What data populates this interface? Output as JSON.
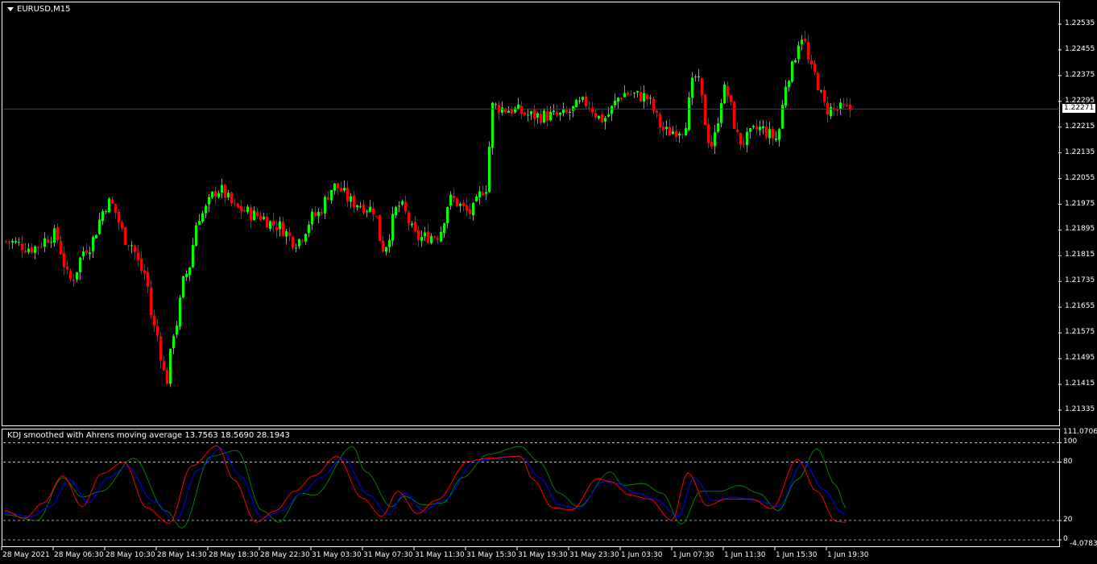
{
  "chart": {
    "title": "EURUSD,M15",
    "symbol": "EURUSD",
    "timeframe": "M15",
    "current_price": "1.22271",
    "price_labels": [
      "1.22535",
      "1.22455",
      "1.22375",
      "1.22295",
      "1.22215",
      "1.22135",
      "1.22055",
      "1.21975",
      "1.21895",
      "1.21815",
      "1.21735",
      "1.21655",
      "1.21575",
      "1.21495",
      "1.21415",
      "1.21335"
    ],
    "time_labels": [
      "28 May 2021",
      "28 May 06:30",
      "28 May 10:30",
      "28 May 14:30",
      "28 May 18:30",
      "28 May 22:30",
      "31 May 03:30",
      "31 May 07:30",
      "31 May 11:30",
      "31 May 15:30",
      "31 May 19:30",
      "31 May 23:30",
      "1 Jun 03:30",
      "1 Jun 07:30",
      "1 Jun 11:30",
      "1 Jun 15:30",
      "1 Jun 19:30"
    ],
    "colors": {
      "background": "#000000",
      "bull": "#00ff00",
      "bear": "#ff0000",
      "price_line": "#3030c0",
      "frame": "#ffffff"
    }
  },
  "indicator": {
    "title": "KDJ smoothed with Ahrens moving average 13.7563 18.5690 28.1943",
    "max_label": "111.0706",
    "level_labels": [
      "100",
      "80",
      "20",
      "0"
    ],
    "min_label": "-4.0783",
    "colors": {
      "k": "#ff0000",
      "d": "#0000ff",
      "j": "#008000",
      "level": "#ffffff"
    }
  },
  "chart_data": {
    "type": "candlestick",
    "title": "EURUSD,M15",
    "ylim": [
      1.2129,
      1.226
    ],
    "close_anchors": [
      [
        0,
        1.2186
      ],
      [
        8,
        1.2184
      ],
      [
        15,
        1.2188
      ],
      [
        20,
        1.2174
      ],
      [
        25,
        1.2184
      ],
      [
        32,
        1.2198
      ],
      [
        38,
        1.2186
      ],
      [
        43,
        1.2176
      ],
      [
        46,
        1.2159
      ],
      [
        50,
        1.2143
      ],
      [
        52,
        1.2158
      ],
      [
        56,
        1.2176
      ],
      [
        60,
        1.2194
      ],
      [
        66,
        1.2202
      ],
      [
        72,
        1.2196
      ],
      [
        78,
        1.2194
      ],
      [
        84,
        1.2191
      ],
      [
        90,
        1.2186
      ],
      [
        96,
        1.2194
      ],
      [
        102,
        1.2203
      ],
      [
        108,
        1.2198
      ],
      [
        114,
        1.2196
      ],
      [
        117,
        1.2184
      ],
      [
        122,
        1.2197
      ],
      [
        128,
        1.2187
      ],
      [
        134,
        1.2188
      ],
      [
        138,
        1.2199
      ],
      [
        144,
        1.2195
      ],
      [
        149,
        1.2203
      ],
      [
        151,
        1.2228
      ],
      [
        156,
        1.2227
      ],
      [
        164,
        1.2225
      ],
      [
        172,
        1.2225
      ],
      [
        180,
        1.2229
      ],
      [
        185,
        1.2224
      ],
      [
        192,
        1.2232
      ],
      [
        198,
        1.2231
      ],
      [
        205,
        1.222
      ],
      [
        210,
        1.2221
      ],
      [
        214,
        1.2237
      ],
      [
        219,
        1.2216
      ],
      [
        223,
        1.2233
      ],
      [
        228,
        1.2217
      ],
      [
        234,
        1.2221
      ],
      [
        239,
        1.2218
      ],
      [
        243,
        1.2238
      ],
      [
        247,
        1.225
      ],
      [
        250,
        1.2239
      ],
      [
        255,
        1.2227
      ],
      [
        259,
        1.2227
      ],
      [
        262,
        1.2227
      ]
    ],
    "k_anchors": [
      [
        0,
        30
      ],
      [
        6,
        22
      ],
      [
        12,
        38
      ],
      [
        18,
        66
      ],
      [
        24,
        34
      ],
      [
        30,
        68
      ],
      [
        37,
        80
      ],
      [
        44,
        33
      ],
      [
        51,
        17
      ],
      [
        58,
        76
      ],
      [
        66,
        97
      ],
      [
        71,
        62
      ],
      [
        78,
        18
      ],
      [
        84,
        30
      ],
      [
        90,
        50
      ],
      [
        96,
        66
      ],
      [
        103,
        86
      ],
      [
        111,
        43
      ],
      [
        117,
        24
      ],
      [
        122,
        50
      ],
      [
        128,
        27
      ],
      [
        134,
        41
      ],
      [
        144,
        81
      ],
      [
        150,
        84
      ],
      [
        160,
        86
      ],
      [
        164,
        62
      ],
      [
        170,
        33
      ],
      [
        176,
        31
      ],
      [
        184,
        63
      ],
      [
        188,
        60
      ],
      [
        194,
        46
      ],
      [
        200,
        42
      ],
      [
        207,
        20
      ],
      [
        212,
        69
      ],
      [
        218,
        35
      ],
      [
        224,
        42
      ],
      [
        232,
        42
      ],
      [
        238,
        32
      ],
      [
        246,
        83
      ],
      [
        252,
        50
      ],
      [
        258,
        19
      ],
      [
        261,
        18
      ]
    ],
    "d_anchors": [
      [
        0,
        28
      ],
      [
        8,
        24
      ],
      [
        14,
        34
      ],
      [
        20,
        62
      ],
      [
        26,
        38
      ],
      [
        32,
        64
      ],
      [
        38,
        76
      ],
      [
        46,
        40
      ],
      [
        53,
        20
      ],
      [
        60,
        72
      ],
      [
        67,
        94
      ],
      [
        73,
        66
      ],
      [
        80,
        22
      ],
      [
        86,
        30
      ],
      [
        92,
        48
      ],
      [
        98,
        64
      ],
      [
        105,
        84
      ],
      [
        113,
        46
      ],
      [
        119,
        26
      ],
      [
        124,
        48
      ],
      [
        130,
        30
      ],
      [
        136,
        40
      ],
      [
        146,
        80
      ],
      [
        152,
        84
      ],
      [
        160,
        86
      ],
      [
        166,
        64
      ],
      [
        172,
        36
      ],
      [
        178,
        32
      ],
      [
        186,
        60
      ],
      [
        190,
        58
      ],
      [
        196,
        48
      ],
      [
        202,
        42
      ],
      [
        209,
        24
      ],
      [
        214,
        64
      ],
      [
        220,
        40
      ],
      [
        226,
        44
      ],
      [
        234,
        40
      ],
      [
        240,
        34
      ],
      [
        248,
        80
      ],
      [
        254,
        52
      ],
      [
        260,
        28
      ],
      [
        261,
        26
      ]
    ],
    "j_anchors": [
      [
        0,
        26
      ],
      [
        10,
        20
      ],
      [
        18,
        64
      ],
      [
        24,
        44
      ],
      [
        30,
        50
      ],
      [
        40,
        84
      ],
      [
        50,
        30
      ],
      [
        55,
        12
      ],
      [
        64,
        86
      ],
      [
        72,
        92
      ],
      [
        80,
        30
      ],
      [
        85,
        18
      ],
      [
        92,
        48
      ],
      [
        96,
        46
      ],
      [
        108,
        96
      ],
      [
        112,
        70
      ],
      [
        120,
        34
      ],
      [
        124,
        45
      ],
      [
        130,
        36
      ],
      [
        136,
        38
      ],
      [
        142,
        64
      ],
      [
        150,
        88
      ],
      [
        160,
        96
      ],
      [
        166,
        80
      ],
      [
        172,
        48
      ],
      [
        178,
        34
      ],
      [
        188,
        70
      ],
      [
        192,
        56
      ],
      [
        198,
        58
      ],
      [
        204,
        48
      ],
      [
        210,
        16
      ],
      [
        216,
        50
      ],
      [
        222,
        50
      ],
      [
        228,
        56
      ],
      [
        234,
        48
      ],
      [
        240,
        30
      ],
      [
        246,
        62
      ],
      [
        252,
        94
      ],
      [
        258,
        56
      ],
      [
        261,
        33
      ]
    ],
    "levels": [
      100,
      80,
      20,
      0
    ],
    "yrange": [
      -4.0783,
      111.0706
    ]
  }
}
